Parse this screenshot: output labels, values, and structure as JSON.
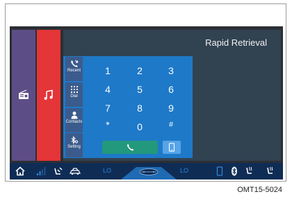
{
  "header": {
    "title": "Rapid Retrieval"
  },
  "sidebar": {
    "tiles": [
      {
        "name": "radio",
        "icon": "radio-icon",
        "color": "#5d4d86"
      },
      {
        "name": "music",
        "icon": "music-note-icon",
        "color": "#e43538"
      }
    ]
  },
  "phone": {
    "menu": [
      {
        "label": "Recent",
        "icon": "recent-calls-icon"
      },
      {
        "label": "Dial",
        "icon": "dialpad-icon"
      },
      {
        "label": "Contacts",
        "icon": "contacts-icon"
      },
      {
        "label": "Setting",
        "icon": "bluetooth-settings-icon"
      }
    ],
    "keys": [
      "1",
      "2",
      "3",
      "4",
      "5",
      "6",
      "7",
      "8",
      "9",
      "*",
      "0",
      "#"
    ],
    "call_icon": "phone-handset-icon",
    "mobile_icon": "mobile-phone-icon",
    "colors": {
      "panel": "#1e79c8",
      "call": "#22997c",
      "mobile": "#56a4e8"
    }
  },
  "bottom_bar": {
    "left_temp": "LO",
    "right_temp": "LO",
    "icons": [
      "home-icon",
      "signal-bars-icon",
      "seat-airflow-icon",
      "recirculation-icon",
      "fan-icon",
      "phone-status-icon",
      "bluetooth-icon",
      "seat-heat-left-icon",
      "seat-heat-right-icon"
    ]
  },
  "caption": "OMT15-5024"
}
